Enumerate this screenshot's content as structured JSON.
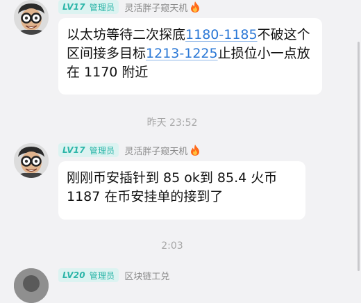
{
  "messages": [
    {
      "level": "LV17",
      "role": "管理员",
      "username": "灵活胖子窥天机",
      "text_parts": [
        "以太坊等待二次探底",
        "1180-1185",
        "不破这个区间接多目标",
        "1213-1225",
        "止损位小一点放在 1170 附近"
      ]
    },
    {
      "level": "LV17",
      "role": "管理员",
      "username": "灵活胖子窥天机",
      "text": "刚刚币安插针到 85  ok到 85.4  火币 1187 在币安挂单的接到了"
    },
    {
      "level": "LV20",
      "role": "管理员",
      "username": "区块链工兑"
    }
  ],
  "timestamps": [
    "昨天 23:52",
    "2:03"
  ],
  "colors": {
    "badge_bg": "#dcf3f1",
    "badge_text": "#2bb5a8",
    "link": "#2b78d6",
    "background": "#f2f2f4"
  }
}
